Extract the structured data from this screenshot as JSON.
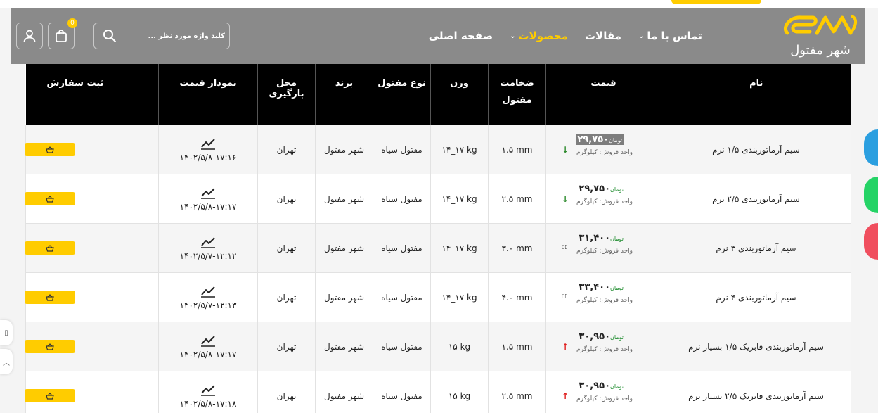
{
  "brand": {
    "logo_mark": "SM",
    "logo_sub": "شهر مفتول",
    "accent": "#ffcc00",
    "header_bg": "#8a8a8a"
  },
  "nav": {
    "items": [
      {
        "label": "صفحه اصلی",
        "dropdown": false,
        "active": false
      },
      {
        "label": "محصولات",
        "dropdown": true,
        "active": true
      },
      {
        "label": "مقالات",
        "dropdown": false,
        "active": false
      },
      {
        "label": "تماس با ما",
        "dropdown": true,
        "active": false
      }
    ]
  },
  "search": {
    "placeholder": "کلید واژه مورد نظر ...",
    "icon": "search-icon"
  },
  "cart": {
    "count": "0",
    "icon": "shopping-bag-icon"
  },
  "account": {
    "icon": "user-icon"
  },
  "table": {
    "headers": {
      "name": "نام",
      "price": "قیمت",
      "thickness": "ضخامت مفتول",
      "weight": "وزن",
      "type": "نوع مفتول",
      "brand": "برند",
      "location": "محل بارگیری",
      "chart": "نمودار قیمت",
      "order": "ثبت سفارش"
    },
    "currency": "تومان",
    "unit_label": "واحد فروش: کیلوگرم",
    "rows": [
      {
        "name": "سیم آرماتوربندی ۱/۵ نرم",
        "price": "۲۹,۷۵۰",
        "trend": "down",
        "highlighted": true,
        "thickness": "۱.۵ mm",
        "weight": "۱۴_۱۷ kg",
        "type": "مفتول سیاه",
        "brand": "شهر مفتول",
        "location": "تهران",
        "timestamp": "۱۴۰۲/۵/۸-۱۷:۱۶"
      },
      {
        "name": "سیم آرماتوربندی ۲/۵ نرم",
        "price": "۲۹,۷۵۰",
        "trend": "down",
        "highlighted": false,
        "thickness": "۲.۵ mm",
        "weight": "۱۴_۱۷ kg",
        "type": "مفتول سیاه",
        "brand": "شهر مفتول",
        "location": "تهران",
        "timestamp": "۱۴۰۲/۵/۸-۱۷:۱۷"
      },
      {
        "name": "سیم آرماتوربندی ۳ نرم",
        "price": "۳۱,۴۰۰",
        "trend": "eq",
        "highlighted": false,
        "thickness": "۳.۰ mm",
        "weight": "۱۴_۱۷ kg",
        "type": "مفتول سیاه",
        "brand": "شهر مفتول",
        "location": "تهران",
        "timestamp": "۱۴۰۲/۵/۷-۱۲:۱۲"
      },
      {
        "name": "سیم آرماتوربندی ۴ نرم",
        "price": "۳۳,۴۰۰",
        "trend": "eq",
        "highlighted": false,
        "thickness": "۴.۰ mm",
        "weight": "۱۴_۱۷ kg",
        "type": "مفتول سیاه",
        "brand": "شهر مفتول",
        "location": "تهران",
        "timestamp": "۱۴۰۲/۵/۷-۱۲:۱۳"
      },
      {
        "name": "سیم آرماتوربندی فابریک ۱/۵ بسیار نرم",
        "price": "۳۰,۹۵۰",
        "trend": "up",
        "highlighted": false,
        "thickness": "۱.۵ mm",
        "weight": "۱۵ kg",
        "type": "مفتول سیاه",
        "brand": "شهر مفتول",
        "location": "تهران",
        "timestamp": "۱۴۰۲/۵/۸-۱۷:۱۷"
      },
      {
        "name": "سیم آرماتوربندی فابریک ۲/۵ بسیار نرم",
        "price": "۳۰,۹۵۰",
        "trend": "up",
        "highlighted": false,
        "thickness": "۲.۵ mm",
        "weight": "۱۵ kg",
        "type": "مفتول سیاه",
        "brand": "شهر مفتول",
        "location": "تهران",
        "timestamp": "۱۴۰۲/۵/۸-۱۷:۱۸"
      }
    ]
  },
  "floating": {
    "colors": [
      "#2b9fe0",
      "#25d366",
      "#f04e5e"
    ]
  }
}
